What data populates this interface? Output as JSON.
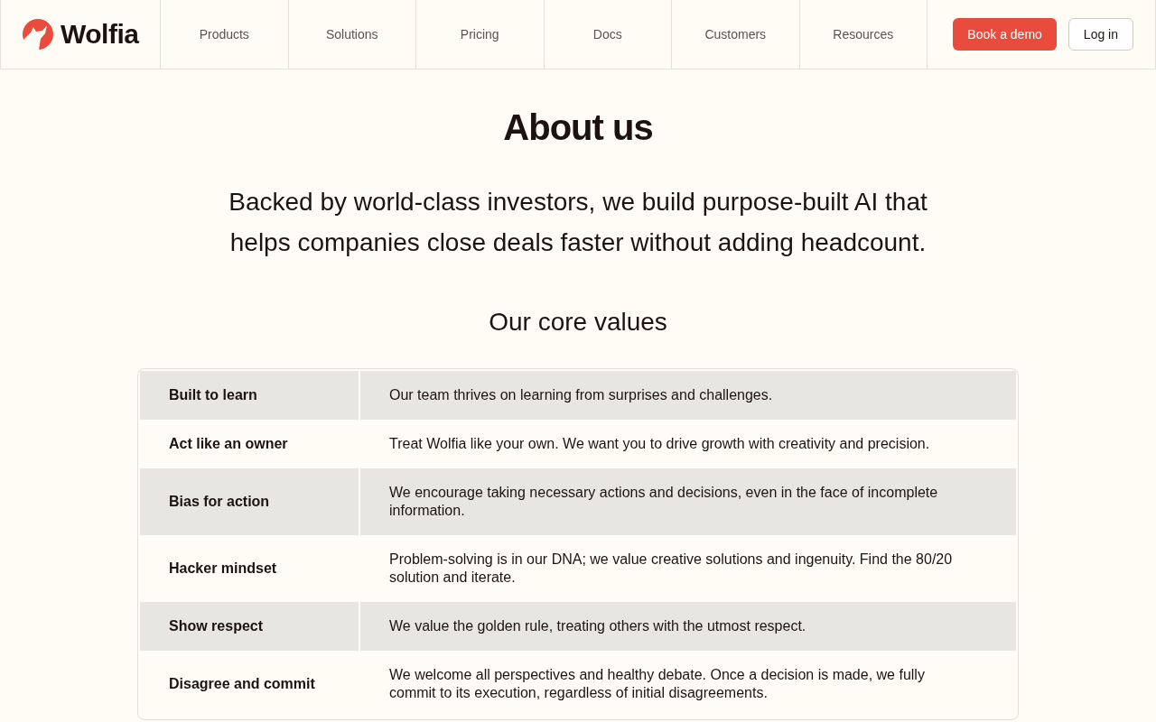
{
  "header": {
    "brand": "Wolfia",
    "nav": [
      "Products",
      "Solutions",
      "Pricing",
      "Docs",
      "Customers",
      "Resources"
    ],
    "buttons": [
      {
        "label": "Book a demo",
        "kind": "primary"
      },
      {
        "label": "Log in",
        "kind": "secondary"
      }
    ]
  },
  "hero": {
    "title": "About us",
    "text": "Backed by world-class investors, we build purpose-built AI that helps companies close deals faster without adding headcount."
  },
  "values": {
    "title": "Our core values",
    "rows": [
      {
        "name": "Built to learn",
        "description": "Our team thrives on learning from surprises and challenges."
      },
      {
        "name": "Act like an owner",
        "description": "Treat Wolfia like your own. We want you to drive growth with creativity and precision."
      },
      {
        "name": "Bias for action",
        "description": "We encourage taking necessary actions and decisions, even in the face of incomplete information."
      },
      {
        "name": "Hacker mindset",
        "description": "Problem-solving is in our DNA; we value creative solutions and ingenuity. Find the 80/20 solution and iterate."
      },
      {
        "name": "Show respect",
        "description": "We value the golden rule, treating others with the utmost respect."
      },
      {
        "name": "Disagree and commit",
        "description": "We welcome all perspectives and healthy debate. Once a decision is made, we fully commit to its execution, regardless of initial disagreements."
      }
    ]
  }
}
